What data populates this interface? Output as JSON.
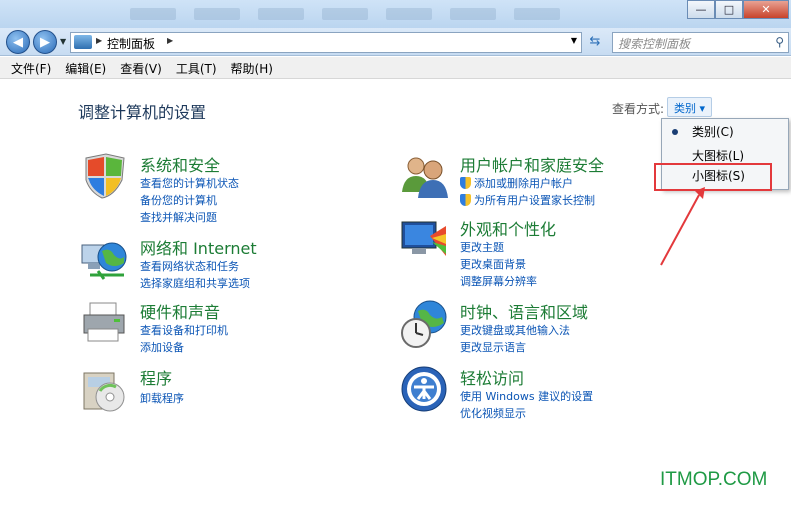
{
  "window": {
    "minimize_icon": "minimize-icon",
    "maximize_icon": "maximize-icon",
    "close_icon": "close-icon",
    "min_glyph": "—",
    "max_glyph": "□",
    "close_glyph": "✕"
  },
  "navigation": {
    "back_glyph": "◀",
    "forward_glyph": "▶",
    "address_path": "控制面板",
    "search_placeholder": "搜索控制面板"
  },
  "menu": [
    "文件(F)",
    "编辑(E)",
    "查看(V)",
    "工具(T)",
    "帮助(H)"
  ],
  "main": {
    "heading": "调整计算机的设置",
    "view_by_label": "查看方式:",
    "view_by_value": "类别 ▾"
  },
  "categories": [
    {
      "title": "系统和安全",
      "icon": "shield-flag-icon",
      "links": [
        "查看您的计算机状态",
        "备份您的计算机",
        "查找并解决问题"
      ]
    },
    {
      "title": "网络和 Internet",
      "icon": "network-globe-icon",
      "links": [
        "查看网络状态和任务",
        "选择家庭组和共享选项"
      ]
    },
    {
      "title": "硬件和声音",
      "icon": "printer-icon",
      "links": [
        "查看设备和打印机",
        "添加设备"
      ]
    },
    {
      "title": "程序",
      "icon": "programs-disc-icon",
      "links": [
        "卸载程序"
      ]
    },
    {
      "title": "用户帐户和家庭安全",
      "icon": "users-icon",
      "links": [
        "添加或删除用户帐户",
        "为所有用户设置家长控制"
      ]
    },
    {
      "title": "外观和个性化",
      "icon": "monitor-palette-icon",
      "links": [
        "更改主题",
        "更改桌面背景",
        "调整屏幕分辨率"
      ]
    },
    {
      "title": "时钟、语言和区域",
      "icon": "clock-globe-icon",
      "links": [
        "更改键盘或其他输入法",
        "更改显示语言"
      ]
    },
    {
      "title": "轻松访问",
      "icon": "ease-of-access-icon",
      "links": [
        "使用 Windows 建议的设置",
        "优化视频显示"
      ]
    }
  ],
  "view_dropdown": {
    "options": [
      "类别(C)",
      "大图标(L)",
      "小图标(S)"
    ],
    "selected": "类别(C)"
  },
  "watermark": "ITMOP.COM",
  "colors": {
    "title_green": "#1c7c35",
    "link_blue": "#0b55b5",
    "highlight_red": "#e3393c"
  }
}
